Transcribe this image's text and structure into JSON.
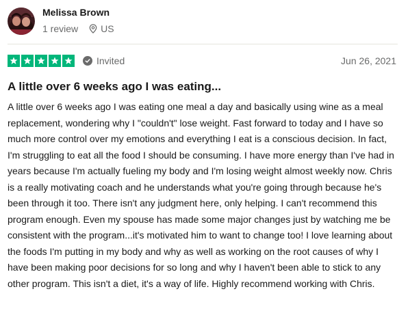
{
  "reviewer": {
    "name": "Melissa Brown",
    "review_count": "1 review",
    "country": "US"
  },
  "rating": {
    "stars": 5,
    "max_stars": 5,
    "star_color": "#00b67a",
    "invited_label": "Invited",
    "date": "Jun 26, 2021"
  },
  "review": {
    "title": "A little over 6 weeks ago I was eating...",
    "body": "A little over 6 weeks ago I was eating one meal a day and basically using wine as a meal replacement, wondering why I \"couldn't\" lose weight. Fast forward to today and I have so much more control over my emotions and everything I eat is a conscious decision. In fact, I'm struggling to eat all the food I should be consuming. I have more energy than I've had in years because I'm actually fueling my body and I'm losing weight almost weekly now. Chris is a really motivating coach and he understands what you're going through because he's been through it too. There isn't any judgment here, only helping. I can't recommend this program enough. Even my spouse has made some major changes just by watching me be consistent with the program...it's motivated him to want to change too! I love learning about the foods I'm putting in my body and why as well as working on the root causes of why I have been making poor decisions for so long and why I haven't been able to stick to any other program. This isn't a diet, it's a way of life. Highly recommend working with Chris."
  }
}
